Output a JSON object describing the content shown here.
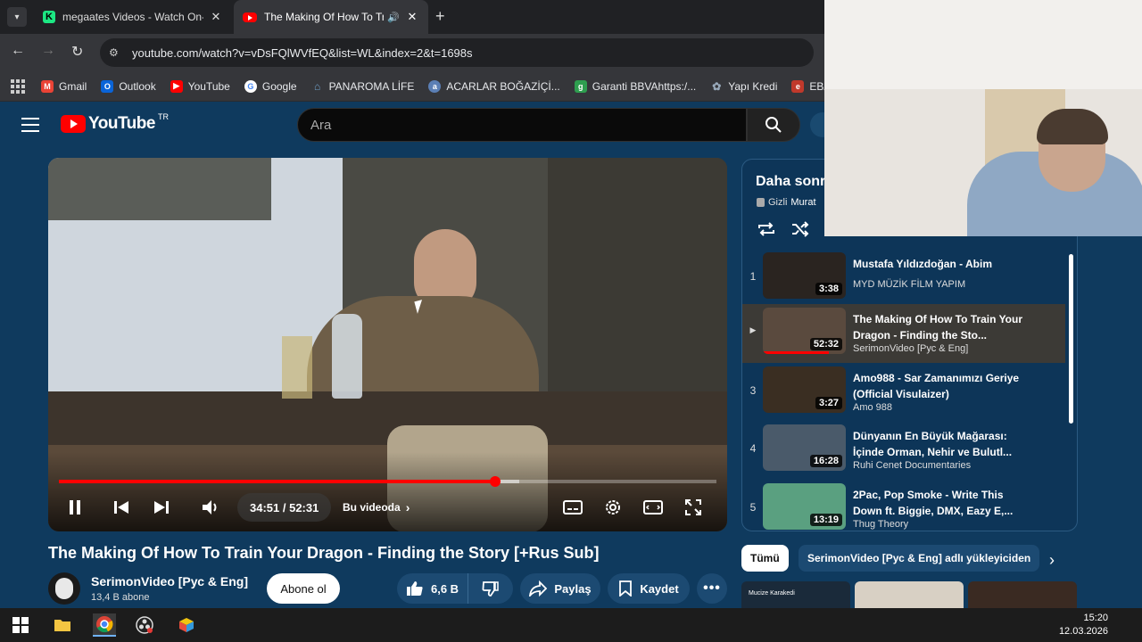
{
  "browser": {
    "tabs": [
      {
        "title": "megaates Videos - Watch On-D",
        "icon": "kick-icon"
      },
      {
        "title": "The Making Of How To Trai",
        "icon": "youtube-icon",
        "playing_audio": true
      }
    ],
    "url": "youtube.com/watch?v=vDsFQlWVfEQ&list=WL&index=2&t=1698s",
    "bookmarks": [
      {
        "label": "Gmail",
        "color": "#ea4335"
      },
      {
        "label": "Outlook",
        "color": "#0a64d8"
      },
      {
        "label": "YouTube",
        "color": "#ff0000"
      },
      {
        "label": "Google",
        "color": "#4285f4"
      },
      {
        "label": "PANAROMA LİFE",
        "color": "#6fa0c8"
      },
      {
        "label": "ACARLAR BOĞAZİÇİ...",
        "color": "#5b7fb5"
      },
      {
        "label": "Garanti BBVAhttps:/...",
        "color": "#2e9e4f"
      },
      {
        "label": "Yapı Kredi",
        "color": "#2a5fa8"
      },
      {
        "label": "EBA Hesabı",
        "color": "#c0392b"
      }
    ]
  },
  "youtube": {
    "logo_text": "YouTube",
    "country_code": "TR",
    "search_placeholder": "Ara"
  },
  "player": {
    "time_display": "34:51 / 52:31",
    "chapter_label": "Bu videoda",
    "progress_fraction": 0.6636,
    "buffered_fraction": 0.7
  },
  "video": {
    "title": "The Making Of How To Train Your Dragon - Finding the Story [+Rus Sub]",
    "channel": "SerimonVideo [Рус & Eng]",
    "subscribers": "13,4 B abone",
    "subscribe_label": "Abone ol",
    "likes": "6,6 B",
    "share_label": "Paylaş",
    "save_label": "Kaydet"
  },
  "playlist": {
    "title": "Daha sonr",
    "privacy": "Gizli",
    "owner": "Murat",
    "items": [
      {
        "index": "1",
        "title": "Mustafa Yıldızdoğan - Abim",
        "channel": "MYD MÜZİK FİLM YAPIM",
        "duration": "3:38",
        "thumb_color": "#2a2420",
        "active": false
      },
      {
        "index": "▶",
        "title": "The Making Of How To Train Your Dragon - Finding the Sto...",
        "channel": "SerimonVideo [Рус & Eng]",
        "duration": "52:32",
        "thumb_color": "#5a4a3e",
        "active": true
      },
      {
        "index": "3",
        "title": "Amo988 - Sar Zamanımızı Geriye (Official Visulaizer)",
        "channel": "Amo 988",
        "duration": "3:27",
        "thumb_color": "#3a2e22",
        "active": false
      },
      {
        "index": "4",
        "title": "Dünyanın En Büyük Mağarası: İçinde Orman, Nehir ve Bulutl...",
        "channel": "Ruhi Cenet Documentaries",
        "duration": "16:28",
        "thumb_color": "#4a5a6a",
        "active": false
      },
      {
        "index": "5",
        "title": "2Pac, Pop Smoke - Write This Down ft. Biggie, DMX, Eazy E,...",
        "channel": "Thug Theory",
        "duration": "13:19",
        "thumb_color": "#5aa080",
        "active": false
      }
    ]
  },
  "chips": {
    "all": "Tümü",
    "uploader": "SerimonVideo [Рус & Eng] adlı yükleyiciden"
  },
  "recommendations": [
    {
      "label": "Mucize Karakedi",
      "color": "#1a2a3a"
    },
    {
      "label": "",
      "color": "#d8d0c4"
    },
    {
      "label": "",
      "color": "#3a2a22"
    }
  ],
  "taskbar": {
    "time": "15:20",
    "date": "12.03.2026"
  }
}
